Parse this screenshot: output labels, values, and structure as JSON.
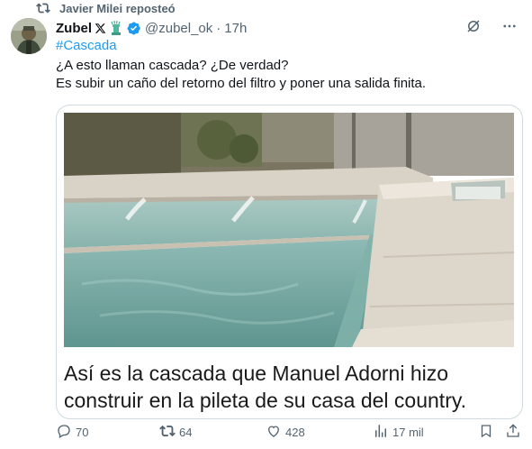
{
  "repost": {
    "text": "Javier Milei reposteó"
  },
  "author": {
    "name": "Zubel",
    "handle": "@zubel_ok",
    "separator": "·",
    "time": "17h"
  },
  "tweet": {
    "hashtag": "#Cascada",
    "line1": "¿A esto llaman cascada? ¿De verdad?",
    "line2": "Es subir un caño del retorno del filtro y poner una salida finita."
  },
  "media": {
    "caption_line1": "Así es la cascada que Manuel Adorni hizo",
    "caption_line2": "construir en la pileta de su casa del country."
  },
  "actions": {
    "replies": "70",
    "reposts": "64",
    "likes": "428",
    "views": "17 mil"
  },
  "colors": {
    "accent": "#1d9bf0",
    "muted": "#536471",
    "repost_green": "#00ba7c",
    "pool_water": "#6fa3a0",
    "stone": "#d9d2c6"
  }
}
